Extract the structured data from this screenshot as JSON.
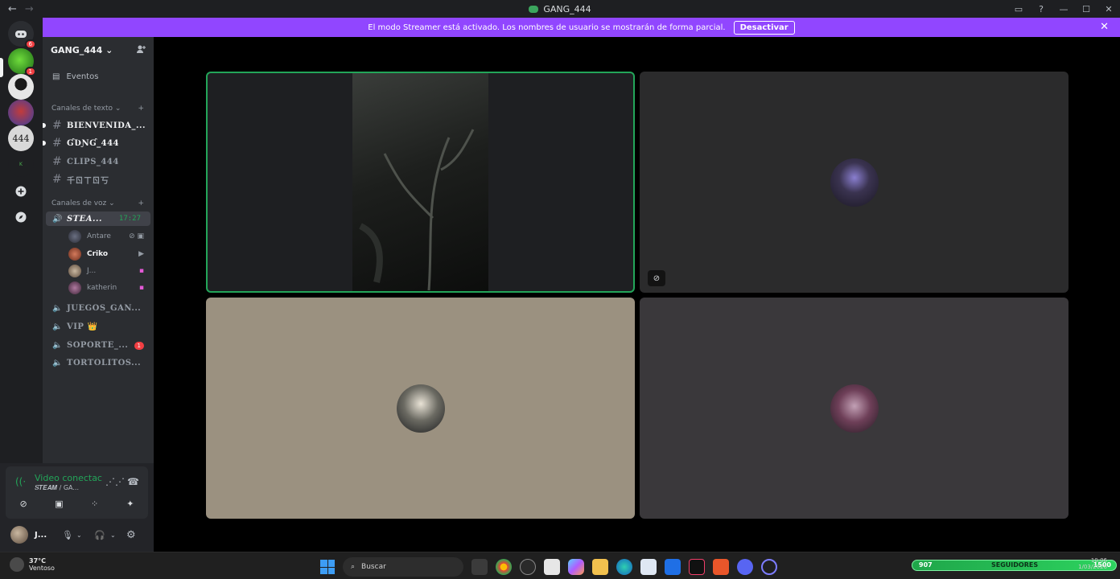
{
  "titlebar": {
    "back_icon": "arrow-left-icon",
    "forward_icon": "arrow-right-icon",
    "title": "GANG_444"
  },
  "banner": {
    "text": "El modo Streamer está activado. Los nombres de usuario se mostrarán de forma parcial.",
    "button": "Desactivar",
    "color": "#9146ff"
  },
  "servers": {
    "home_badge": "6",
    "gang_badge": "1"
  },
  "sidebar": {
    "guild_name": "GANG_444",
    "events_label": "Eventos",
    "text_category": "Canales de texto",
    "text_channels": [
      {
        "name": "BIENVENIDA_..."
      },
      {
        "name": "ƓƲƝƓ_444"
      },
      {
        "name": "CLIPS_444"
      },
      {
        "name": "千ㄖㄒㄖ丂"
      }
    ],
    "voice_category": "Canales de voz",
    "active_voice": {
      "name": "𝑺𝑻𝑬𝑨...",
      "timer": "17:27"
    },
    "voice_users": [
      {
        "name": "Antare"
      },
      {
        "name": "Criko"
      },
      {
        "name": "J..."
      },
      {
        "name": "katherin"
      }
    ],
    "voice_channels": [
      {
        "name": "JUEGOS_GAN..."
      },
      {
        "name": "VIP 👑"
      },
      {
        "name": "SOPORTE_...",
        "badge": "1"
      },
      {
        "name": "TORTOLITOS..."
      }
    ]
  },
  "userpanel": {
    "status": "Video conectac",
    "channel_path": "𝑺𝑻𝑬𝑨𝑴 / GA...",
    "username": "J...",
    "accent": "#23a559"
  },
  "taskbar": {
    "weather_temp": "37°C",
    "weather_desc": "Ventoso",
    "search_placeholder": "Buscar",
    "followers_left": "907",
    "followers_label": "SEGUIDORES",
    "followers_right": "1500",
    "time": "10:06",
    "date": "1/03/2026"
  }
}
